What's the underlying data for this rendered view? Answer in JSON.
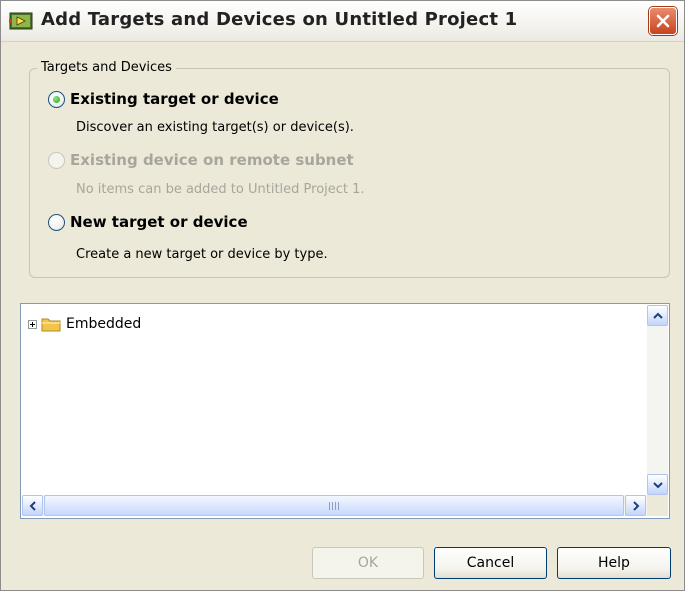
{
  "window": {
    "title": "Add Targets and Devices on Untitled Project 1"
  },
  "group": {
    "legend": "Targets and Devices",
    "options": [
      {
        "label": "Existing target or device",
        "description": "Discover an existing target(s) or device(s).",
        "selected": true,
        "enabled": true
      },
      {
        "label": "Existing device on remote subnet",
        "description": "No items can be added to Untitled Project 1.",
        "selected": false,
        "enabled": false
      },
      {
        "label": "New target or device",
        "description": "Create a new target or device by type.",
        "selected": false,
        "enabled": true
      }
    ]
  },
  "tree": {
    "items": [
      {
        "label": "Embedded",
        "icon": "folder-icon",
        "expanded": false
      }
    ]
  },
  "buttons": {
    "ok": "OK",
    "cancel": "Cancel",
    "help": "Help"
  },
  "colors": {
    "dialog_bg": "#ece9d8",
    "close_red": "#c9431d",
    "radio_green": "#21a121",
    "folder_yellow": "#f3c44c"
  }
}
